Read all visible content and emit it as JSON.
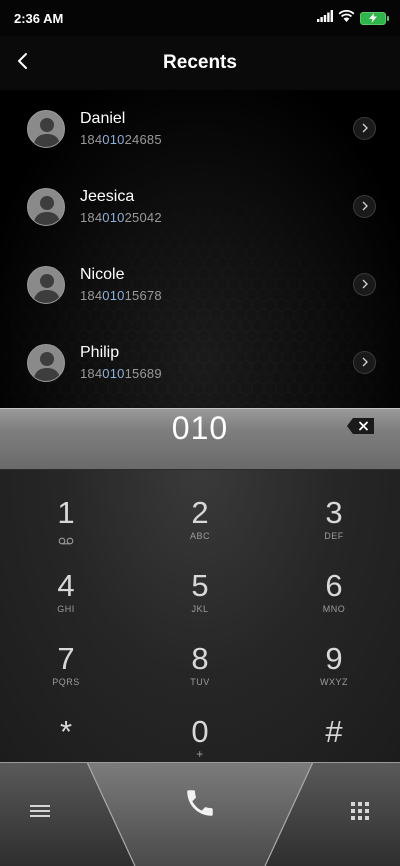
{
  "status_bar": {
    "time": "2:36 AM",
    "icons": [
      "signal-icon",
      "wifi-icon",
      "battery-charging-icon"
    ],
    "battery_color": "#2fb54a"
  },
  "header": {
    "title": "Recents",
    "back_icon": "chevron-left-icon"
  },
  "recents": [
    {
      "name": "Daniel",
      "number_prefix": "184",
      "number_match": "010",
      "number_suffix": "24685"
    },
    {
      "name": "Jeesica",
      "number_prefix": "184",
      "number_match": "010",
      "number_suffix": "25042"
    },
    {
      "name": "Nicole",
      "number_prefix": "184",
      "number_match": "010",
      "number_suffix": "15678"
    },
    {
      "name": "Philip",
      "number_prefix": "184",
      "number_match": "010",
      "number_suffix": "15689"
    }
  ],
  "dialer": {
    "entered_digits": "010",
    "backspace_icon": "backspace-icon",
    "keys": [
      {
        "digit": "1",
        "letters": "",
        "sub_icon": "voicemail-icon"
      },
      {
        "digit": "2",
        "letters": "ABC"
      },
      {
        "digit": "3",
        "letters": "DEF"
      },
      {
        "digit": "4",
        "letters": "GHI"
      },
      {
        "digit": "5",
        "letters": "JKL"
      },
      {
        "digit": "6",
        "letters": "MNO"
      },
      {
        "digit": "7",
        "letters": "PQRS"
      },
      {
        "digit": "8",
        "letters": "TUV"
      },
      {
        "digit": "9",
        "letters": "WXYZ"
      },
      {
        "digit": "*",
        "letters": ""
      },
      {
        "digit": "0",
        "letters": "+"
      },
      {
        "digit": "#",
        "letters": ""
      }
    ]
  },
  "bottom_bar": {
    "menu_icon": "menu-icon",
    "call_icon": "phone-icon",
    "keypad_icon": "dialpad-icon"
  },
  "colors": {
    "match_highlight": "#8fb0d8",
    "number_text": "#9a9a9a"
  }
}
